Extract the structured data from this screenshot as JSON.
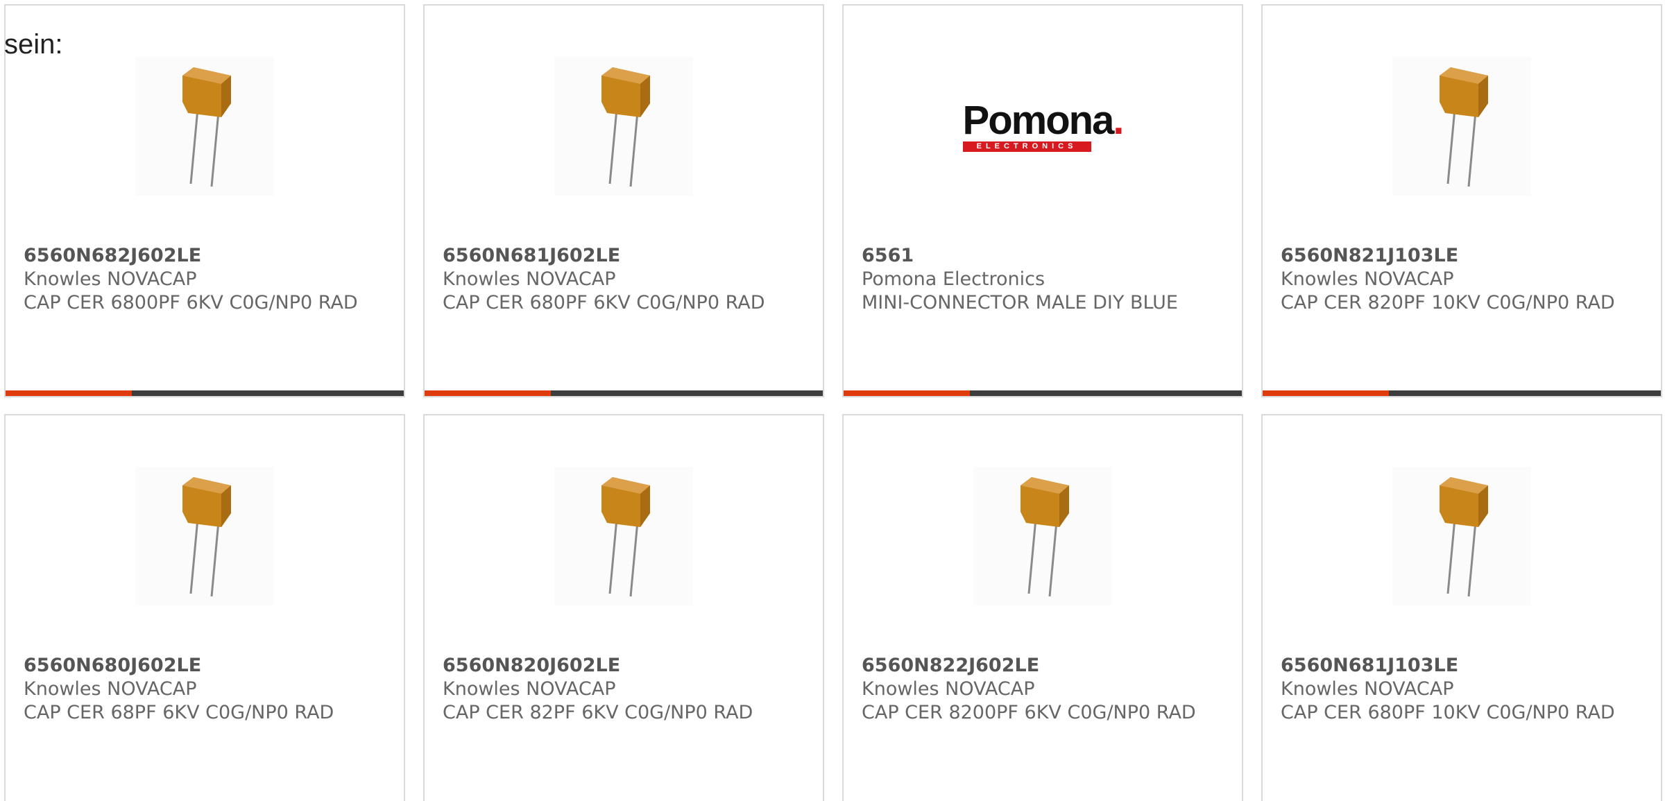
{
  "intro": "sein:",
  "colors": {
    "accent": "#e03a0d",
    "bar": "#3d3d3d",
    "capacitor": "#c8861a",
    "pomona_red": "#d71920"
  },
  "products": [
    {
      "part": "6560N682J602LE",
      "manufacturer": "Knowles NOVACAP",
      "description": "CAP CER 6800PF 6KV C0G/NP0 RAD",
      "image": "capacitor-icon"
    },
    {
      "part": "6560N681J602LE",
      "manufacturer": "Knowles NOVACAP",
      "description": "CAP CER 680PF 6KV C0G/NP0 RAD",
      "image": "capacitor-icon"
    },
    {
      "part": "6561",
      "manufacturer": "Pomona Electronics",
      "description": "MINI-CONNECTOR MALE DIY BLUE",
      "image": "pomona-logo",
      "logo_word": "Pomona",
      "logo_dot": ".",
      "logo_strip": "ELECTRONICS"
    },
    {
      "part": "6560N821J103LE",
      "manufacturer": "Knowles NOVACAP",
      "description": "CAP CER 820PF 10KV C0G/NP0 RAD",
      "image": "capacitor-icon"
    },
    {
      "part": "6560N680J602LE",
      "manufacturer": "Knowles NOVACAP",
      "description": "CAP CER 68PF 6KV C0G/NP0 RAD",
      "image": "capacitor-icon"
    },
    {
      "part": "6560N820J602LE",
      "manufacturer": "Knowles NOVACAP",
      "description": "CAP CER 82PF 6KV C0G/NP0 RAD",
      "image": "capacitor-icon"
    },
    {
      "part": "6560N822J602LE",
      "manufacturer": "Knowles NOVACAP",
      "description": "CAP CER 8200PF 6KV C0G/NP0 RAD",
      "image": "capacitor-icon"
    },
    {
      "part": "6560N681J103LE",
      "manufacturer": "Knowles NOVACAP",
      "description": "CAP CER 680PF 10KV C0G/NP0 RAD",
      "image": "capacitor-icon"
    }
  ]
}
